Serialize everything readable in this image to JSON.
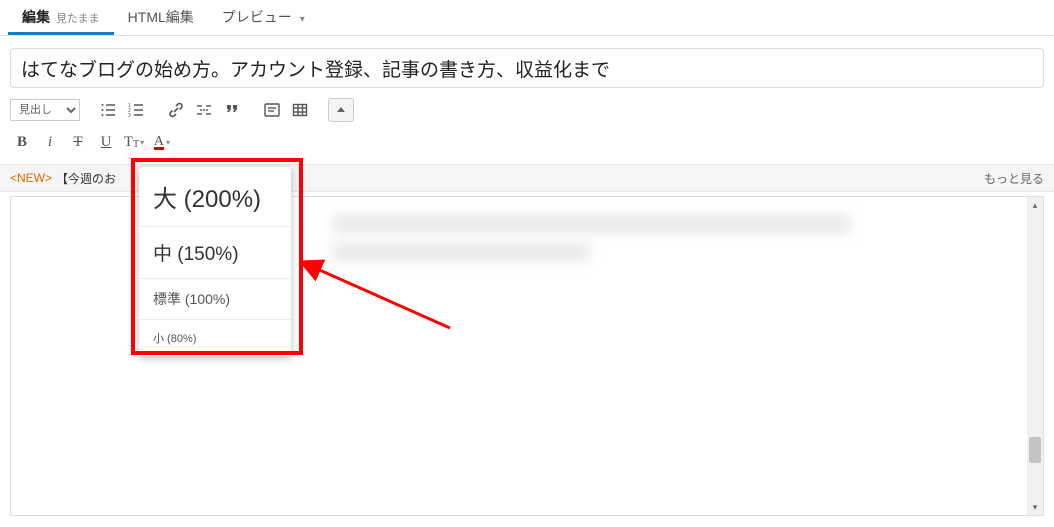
{
  "tabs": {
    "edit": "編集",
    "edit_sub": "見たまま",
    "html": "HTML編集",
    "preview": "プレビュー"
  },
  "title": "はてなブログの始め方。アカウント登録、記事の書き方、収益化まで",
  "toolbar": {
    "heading_label": "見出し"
  },
  "notice": {
    "new": "<NEW>",
    "text": "【今週のお",
    "more": "もっと見る"
  },
  "fontsize_menu": {
    "large": "大 (200%)",
    "medium": "中 (150%)",
    "normal": "標準 (100%)",
    "small": "小 (80%)"
  }
}
